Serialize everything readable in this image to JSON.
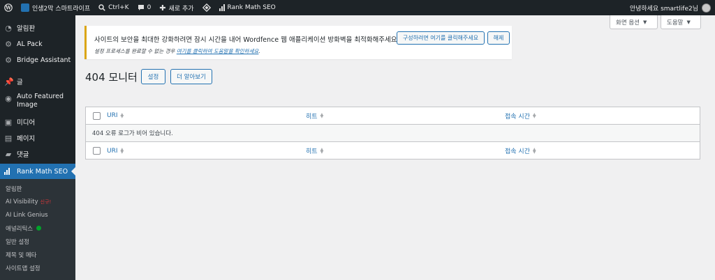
{
  "adminbar": {
    "site_name": "인생2막 스마트라이프",
    "search_shortcut": "Ctrl+K",
    "comments_count": "0",
    "new_label": "새로 추가",
    "rank_math": "Rank Math SEO",
    "greeting": "안녕하세요 smartlife2님"
  },
  "sidebar": {
    "items": [
      {
        "label": "알림판",
        "icon": "dashboard-icon"
      },
      {
        "label": "AL Pack",
        "icon": "gear-icon"
      },
      {
        "label": "Bridge Assistant",
        "icon": "bridge-icon"
      },
      {
        "label": "글",
        "icon": "pin-icon"
      },
      {
        "label": "Auto Featured Image",
        "icon": "image-icon"
      },
      {
        "label": "미디어",
        "icon": "media-icon"
      },
      {
        "label": "페이지",
        "icon": "page-icon"
      },
      {
        "label": "댓글",
        "icon": "comment-icon"
      },
      {
        "label": "Rank Math SEO",
        "icon": "rank-math-icon",
        "active": true
      }
    ],
    "submenu": [
      {
        "label": "알림판"
      },
      {
        "label": "AI Visibility",
        "badge": "신규!"
      },
      {
        "label": "AI Link Genius"
      },
      {
        "label": "애널리틱스",
        "status_dot": true
      },
      {
        "label": "일반 설정"
      },
      {
        "label": "제목 및 메타"
      },
      {
        "label": "사이트맵 설정"
      }
    ]
  },
  "screen_options": {
    "screen_label": "화면 옵션",
    "help_label": "도움말"
  },
  "notice": {
    "message": "사이트의 보안을 최대한 강화하려면 잠시 시간을 내어 Wordfence 웹 애플리케이션 방화벽을 최적화해주세요:",
    "configure_button": "구성하려면 여기를 클릭해주세요",
    "dismiss_button": "해제",
    "note_prefix": "설정 프로세스를 완료할 수 없는 경우",
    "note_link": "여기를 클릭하여 도움말을 확인하세요",
    "note_suffix": "."
  },
  "page": {
    "title": "404 모니터",
    "settings_button": "설정",
    "learn_more_button": "더 알아보기"
  },
  "table": {
    "columns": [
      "URI",
      "히트",
      "접속 시간"
    ],
    "empty_message": "404 오류 로그가 비어 있습니다."
  },
  "colors": {
    "accent": "#2271b1",
    "adminbar_bg": "#1d2327",
    "notice_border": "#dba617"
  }
}
